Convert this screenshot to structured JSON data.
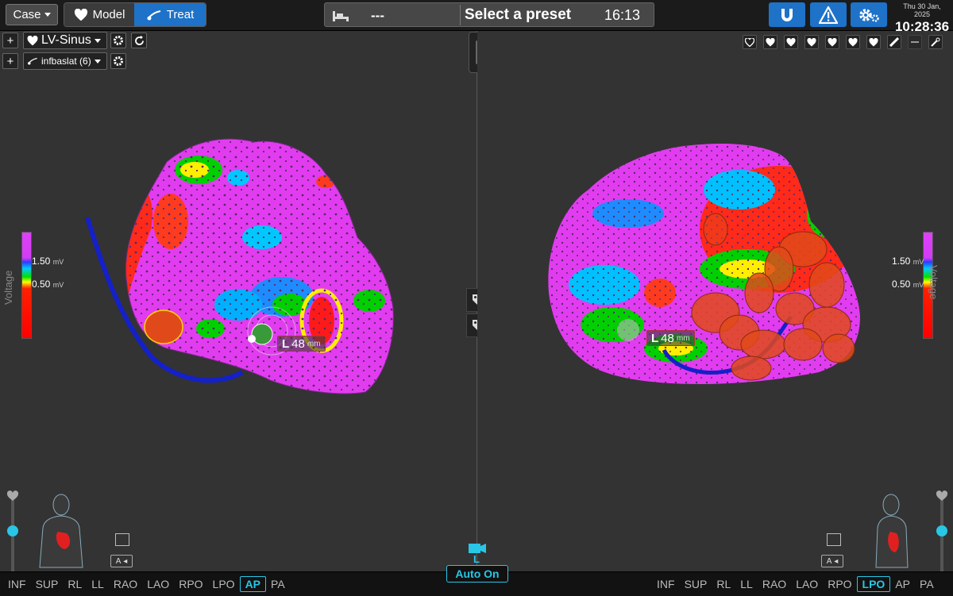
{
  "topbar": {
    "case_label": "Case",
    "model_label": "Model",
    "treat_label": "Treat",
    "status_dashes": "---",
    "preset_label": "Select a preset",
    "timer": "16:13",
    "date": "Thu 30 Jan, 2025",
    "time": "10:28:36",
    "icons": [
      "magnet-icon",
      "warning-icon",
      "settings-icon"
    ],
    "accent_color": "#1e72c8"
  },
  "left_view": {
    "map_name": "LV-Sinus",
    "catheter_name": "infbaslat (6)",
    "colorbar": {
      "high": "1.50",
      "low": "0.50",
      "unit": "mV",
      "title": "Voltage"
    },
    "measure": {
      "letter": "L",
      "value": "48",
      "unit": "mm"
    },
    "views": [
      "INF",
      "SUP",
      "RL",
      "LL",
      "RAO",
      "LAO",
      "RPO",
      "LPO",
      "AP",
      "PA"
    ],
    "selected_view": "AP",
    "cam_label": "A"
  },
  "right_view": {
    "colorbar": {
      "high": "1.50",
      "low": "0.50",
      "unit": "mV",
      "title": "Voltage"
    },
    "measure": {
      "letter": "L",
      "value": "48",
      "unit": "mm"
    },
    "views": [
      "INF",
      "SUP",
      "RL",
      "LL",
      "RAO",
      "LAO",
      "RPO",
      "LPO",
      "AP",
      "PA"
    ],
    "selected_view": "LPO",
    "cam_label": "A"
  },
  "center": {
    "auto_label": "Auto On",
    "auto_letter": "L"
  },
  "colors": {
    "cyan": "#29c6e6",
    "map_magenta": "#e040fb"
  }
}
